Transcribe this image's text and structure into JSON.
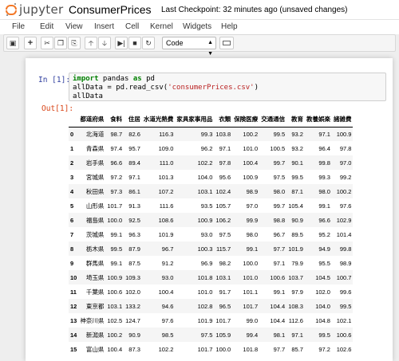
{
  "header": {
    "logo_text": "jupyter",
    "notebook_name": "ConsumerPrices",
    "checkpoint": "Last Checkpoint: 32 minutes ago (unsaved changes)"
  },
  "menu": [
    "File",
    "Edit",
    "View",
    "Insert",
    "Cell",
    "Kernel",
    "Widgets",
    "Help"
  ],
  "toolbar": {
    "cell_type": "Code",
    "buttons": [
      "save-icon",
      "plus-icon",
      "scissors-icon",
      "copy-icon",
      "paste-icon",
      "arrow-up-icon",
      "arrow-down-icon",
      "step-run-icon",
      "stop-icon",
      "restart-icon"
    ]
  },
  "cell": {
    "in_prompt": "In [1]:",
    "out_prompt": "Out[1]:",
    "code": {
      "kw_import": "import",
      "line1_rest": " pandas ",
      "kw_as": "as",
      "line1_end": " pd",
      "line2_start": "allData = pd.read_csv(",
      "line2_str": "'consumerPrices.csv'",
      "line2_end": ")",
      "line3": "allData"
    }
  },
  "table": {
    "columns": [
      "都道府県",
      "食料",
      "住居",
      "水道光熱費",
      "家具家事用品",
      "衣類",
      "保険医療",
      "交通通信",
      "教育",
      "教養娯楽",
      "諸雑費"
    ],
    "rows": [
      [
        "0",
        "北海道",
        "98.7",
        "82.6",
        "116.3",
        "99.3",
        "103.8",
        "100.2",
        "99.5",
        "93.2",
        "97.1",
        "100.9"
      ],
      [
        "1",
        "青森県",
        "97.4",
        "95.7",
        "109.0",
        "96.2",
        "97.1",
        "101.0",
        "100.5",
        "93.2",
        "96.4",
        "97.8"
      ],
      [
        "2",
        "岩手県",
        "96.6",
        "89.4",
        "111.0",
        "102.2",
        "97.8",
        "100.4",
        "99.7",
        "90.1",
        "99.8",
        "97.0"
      ],
      [
        "3",
        "宮城県",
        "97.2",
        "97.1",
        "101.3",
        "104.0",
        "95.6",
        "100.9",
        "97.5",
        "99.5",
        "99.3",
        "99.2"
      ],
      [
        "4",
        "秋田県",
        "97.3",
        "86.1",
        "107.2",
        "103.1",
        "102.4",
        "98.9",
        "98.0",
        "87.1",
        "98.0",
        "100.2"
      ],
      [
        "5",
        "山形県",
        "101.7",
        "91.3",
        "111.6",
        "93.5",
        "105.7",
        "97.0",
        "99.7",
        "105.4",
        "99.1",
        "97.6"
      ],
      [
        "6",
        "福島県",
        "100.0",
        "92.5",
        "108.6",
        "100.9",
        "106.2",
        "99.9",
        "98.8",
        "90.9",
        "96.6",
        "102.9"
      ],
      [
        "7",
        "茨城県",
        "99.1",
        "96.3",
        "101.9",
        "93.0",
        "97.5",
        "98.0",
        "96.7",
        "89.5",
        "95.2",
        "101.4"
      ],
      [
        "8",
        "栃木県",
        "99.5",
        "87.9",
        "96.7",
        "100.3",
        "115.7",
        "99.1",
        "97.7",
        "101.9",
        "94.9",
        "99.8"
      ],
      [
        "9",
        "群馬県",
        "99.1",
        "87.5",
        "91.2",
        "96.9",
        "98.2",
        "100.0",
        "97.1",
        "79.9",
        "95.5",
        "98.9"
      ],
      [
        "10",
        "埼玉県",
        "100.9",
        "109.3",
        "93.0",
        "101.8",
        "103.1",
        "101.0",
        "100.6",
        "103.7",
        "104.5",
        "100.7"
      ],
      [
        "11",
        "千葉県",
        "100.6",
        "102.0",
        "100.4",
        "101.0",
        "91.7",
        "101.1",
        "99.1",
        "97.9",
        "102.0",
        "99.6"
      ],
      [
        "12",
        "東京都",
        "103.1",
        "133.2",
        "94.6",
        "102.8",
        "96.5",
        "101.7",
        "104.4",
        "108.3",
        "104.0",
        "99.5"
      ],
      [
        "13",
        "神奈川県",
        "102.5",
        "124.7",
        "97.6",
        "101.9",
        "101.7",
        "99.0",
        "104.4",
        "112.6",
        "104.8",
        "102.1"
      ],
      [
        "14",
        "新潟県",
        "100.2",
        "90.9",
        "98.5",
        "97.5",
        "105.9",
        "99.4",
        "98.1",
        "97.1",
        "99.5",
        "100.6"
      ],
      [
        "15",
        "富山県",
        "100.4",
        "87.3",
        "102.2",
        "101.7",
        "100.0",
        "101.8",
        "97.7",
        "85.7",
        "97.2",
        "102.6"
      ]
    ]
  }
}
